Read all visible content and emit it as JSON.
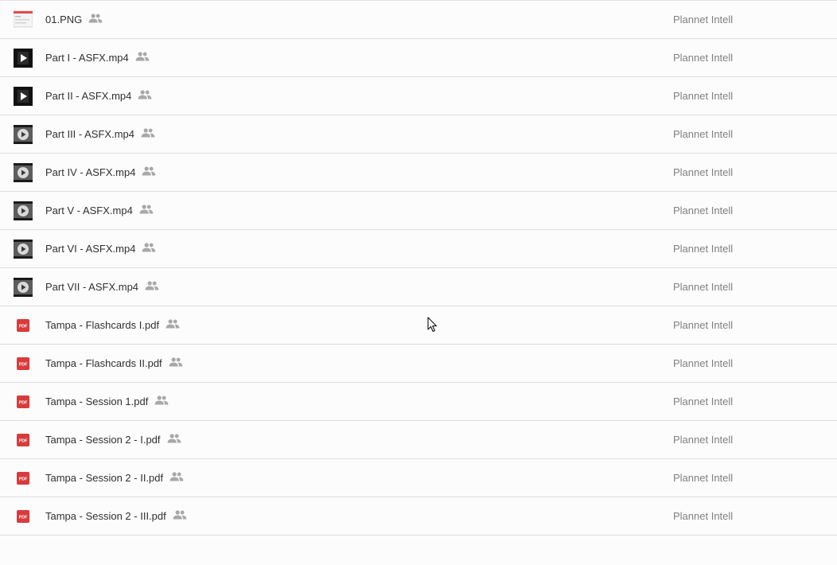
{
  "files": [
    {
      "name": "01.PNG",
      "type": "image",
      "owner": "Plannet Intell",
      "shared": true
    },
    {
      "name": "Part I - ASFX.mp4",
      "type": "video-square",
      "owner": "Plannet Intell",
      "shared": true
    },
    {
      "name": "Part II - ASFX.mp4",
      "type": "video-square",
      "owner": "Plannet Intell",
      "shared": true
    },
    {
      "name": "Part III - ASFX.mp4",
      "type": "video",
      "owner": "Plannet Intell",
      "shared": true
    },
    {
      "name": "Part IV - ASFX.mp4",
      "type": "video",
      "owner": "Plannet Intell",
      "shared": true
    },
    {
      "name": "Part V - ASFX.mp4",
      "type": "video",
      "owner": "Plannet Intell",
      "shared": true
    },
    {
      "name": "Part VI - ASFX.mp4",
      "type": "video",
      "owner": "Plannet Intell",
      "shared": true
    },
    {
      "name": "Part VII - ASFX.mp4",
      "type": "video",
      "owner": "Plannet Intell",
      "shared": true
    },
    {
      "name": "Tampa - Flashcards I.pdf",
      "type": "pdf",
      "owner": "Plannet Intell",
      "shared": true
    },
    {
      "name": "Tampa - Flashcards II.pdf",
      "type": "pdf",
      "owner": "Plannet Intell",
      "shared": true
    },
    {
      "name": "Tampa - Session 1.pdf",
      "type": "pdf",
      "owner": "Plannet Intell",
      "shared": true
    },
    {
      "name": "Tampa - Session 2 - I.pdf",
      "type": "pdf",
      "owner": "Plannet Intell",
      "shared": true
    },
    {
      "name": "Tampa - Session 2 - II.pdf",
      "type": "pdf",
      "owner": "Plannet Intell",
      "shared": true
    },
    {
      "name": "Tampa - Session 2 - III.pdf",
      "type": "pdf",
      "owner": "Plannet Intell",
      "shared": true
    }
  ],
  "icons": {
    "image": "image-thumbnail-icon",
    "video-square": "video-thumbnail-icon",
    "video": "video-thumbnail-icon",
    "pdf": "pdf-file-icon",
    "shared": "shared-people-icon",
    "cursor": "mouse-cursor-icon"
  },
  "colors": {
    "pdf_red": "#d93b3b",
    "shared_icon": "#a8a8a8",
    "owner_text": "#808080",
    "name_text": "#303030",
    "divider": "#dedede"
  }
}
